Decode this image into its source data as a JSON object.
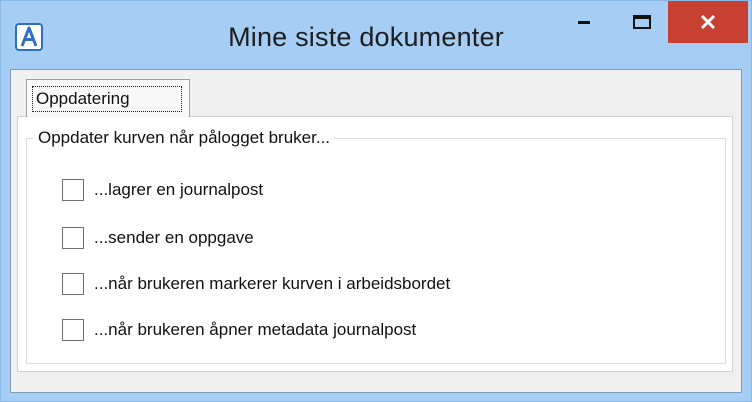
{
  "window": {
    "title": "Mine siste dokumenter",
    "app_icon": "letter-a-icon",
    "controls": {
      "minimize": "minimize-icon",
      "maximize": "maximize-icon",
      "close": "close-icon"
    },
    "colors": {
      "frame": "#a6cdf3",
      "close_button": "#c84031",
      "app_icon": "#2e6fc4"
    }
  },
  "tabs": [
    {
      "label": "Oppdatering",
      "selected": true
    }
  ],
  "group": {
    "title": "Oppdater kurven når pålogget bruker...",
    "options": [
      {
        "label": "...lagrer en journalpost",
        "checked": false
      },
      {
        "label": "...sender en oppgave",
        "checked": false
      },
      {
        "label": "...når brukeren markerer kurven i arbeidsbordet",
        "checked": false
      },
      {
        "label": "...når brukeren åpner metadata journalpost",
        "checked": false
      }
    ]
  }
}
